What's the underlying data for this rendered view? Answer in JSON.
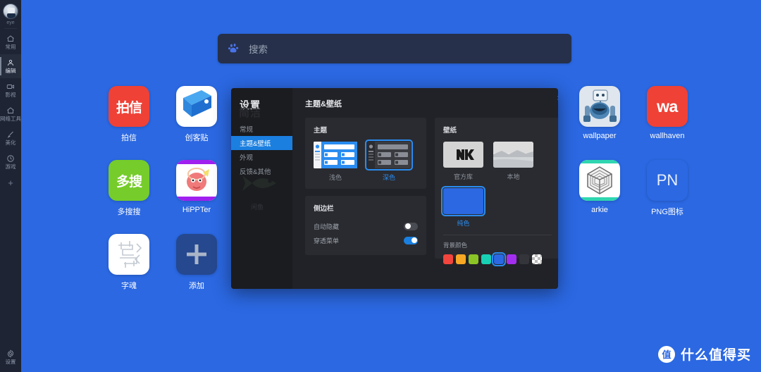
{
  "colors": {
    "desktop_background": "#2b68e2",
    "rail_background": "#1e2433",
    "dialog_background": "#212227",
    "dialog_sidebar": "#1b1c20",
    "panel_background": "#2a2b30",
    "accent_blue": "#1b7fe0",
    "highlight_blue": "#2a8cf0"
  },
  "left_rail": {
    "avatar_label": "eye",
    "avatar_icon": "robot-avatar-icon",
    "items": [
      {
        "label": "常用",
        "icon": "home-icon",
        "active": false
      },
      {
        "label": "编辑",
        "icon": "person-icon",
        "active": true
      },
      {
        "label": "影视",
        "icon": "video-icon",
        "active": false
      },
      {
        "label": "网络工具",
        "icon": "home-icon",
        "active": false
      },
      {
        "label": "美化",
        "icon": "brush-icon",
        "active": false
      },
      {
        "label": "游戏",
        "icon": "gamepad-icon",
        "active": false
      }
    ],
    "add_label": "+",
    "bottom": {
      "label": "设置",
      "icon": "gear-icon"
    }
  },
  "search": {
    "placeholder": "搜索",
    "engine_icon": "baidu-paw-icon"
  },
  "desktop": {
    "left_apps": [
      {
        "name": "拍信",
        "tile_text": "拍信",
        "tile_kind": "cn-text",
        "bg": "#ef4136",
        "fg": "#ffffff"
      },
      {
        "name": "创客贴",
        "tile_text": "",
        "tile_kind": "chuangke",
        "bg": "#ffffff",
        "fg": "#2f9ae8"
      },
      {
        "name": "多搜搜",
        "tile_text": "多搜",
        "tile_kind": "cn-text",
        "bg": "#76cc2b",
        "fg": "#ffffff"
      },
      {
        "name": "HiPPTer",
        "tile_text": "",
        "tile_kind": "hippter",
        "bg": "#ffffff",
        "fg": "#a020f0"
      },
      {
        "name": "字魂",
        "tile_text": "",
        "tile_kind": "ziHun",
        "bg": "#ffffff",
        "fg": "#b9c0c8"
      },
      {
        "name": "添加",
        "tile_text": "+",
        "tile_kind": "add",
        "bg": "#25488f",
        "fg": "#aab6c8"
      }
    ],
    "right_apps": [
      {
        "name": "wallpaper",
        "tile_text": "",
        "tile_kind": "robot",
        "bg": "#dfe6ee",
        "fg": "#3b6f9c"
      },
      {
        "name": "wallhaven",
        "tile_text": "wa",
        "tile_kind": "wa",
        "bg": "#ef4136",
        "fg": "#ffffff"
      },
      {
        "name": "arkie",
        "tile_text": "",
        "tile_kind": "arkie",
        "bg": "#ffffff",
        "fg": "#2fd6b0"
      },
      {
        "name": "PNG图标",
        "tile_text": "PN",
        "tile_kind": "pn",
        "bg": "#2b68e2",
        "fg": "#e8eefb"
      }
    ]
  },
  "settings_dialog": {
    "sidebar_title": "设置",
    "sidebar_ghost": "简洁",
    "nav_items": [
      {
        "label": "常规",
        "active": false
      },
      {
        "label": "主题&壁纸",
        "active": true
      },
      {
        "label": "外观",
        "active": false
      },
      {
        "label": "反馈&其他",
        "active": false
      }
    ],
    "decor_label": "闲鱼",
    "decor_icon": "fish-icon",
    "heading": "主题&壁纸",
    "close_label": "×",
    "theme_panel": {
      "title": "主题",
      "options": [
        {
          "label": "浅色",
          "mode": "light",
          "selected": false
        },
        {
          "label": "深色",
          "mode": "dark",
          "selected": true
        }
      ]
    },
    "sidebar_panel": {
      "title": "侧边栏",
      "toggles": [
        {
          "label": "自动隐藏",
          "on": false
        },
        {
          "label": "穿透菜单",
          "on": true
        }
      ]
    },
    "wallpaper_panel": {
      "title": "壁纸",
      "options": [
        {
          "label": "官方库",
          "kind": "official",
          "selected": false
        },
        {
          "label": "本地",
          "kind": "local",
          "selected": false
        },
        {
          "label": "纯色",
          "kind": "solid",
          "selected": true
        }
      ],
      "bgcolor_title": "背景颜色",
      "swatches": [
        {
          "color": "#f2453d",
          "selected": false
        },
        {
          "color": "#f9a825",
          "selected": false
        },
        {
          "color": "#8bc425",
          "selected": false
        },
        {
          "color": "#18d1b4",
          "selected": false
        },
        {
          "color": "#2b68e2",
          "selected": true
        },
        {
          "color": "#a32ef0",
          "selected": false
        },
        {
          "color": "#34353a",
          "selected": false
        },
        {
          "color": "checker",
          "selected": false
        }
      ]
    }
  },
  "watermark": {
    "logo_char": "值",
    "text": "什么值得买"
  }
}
